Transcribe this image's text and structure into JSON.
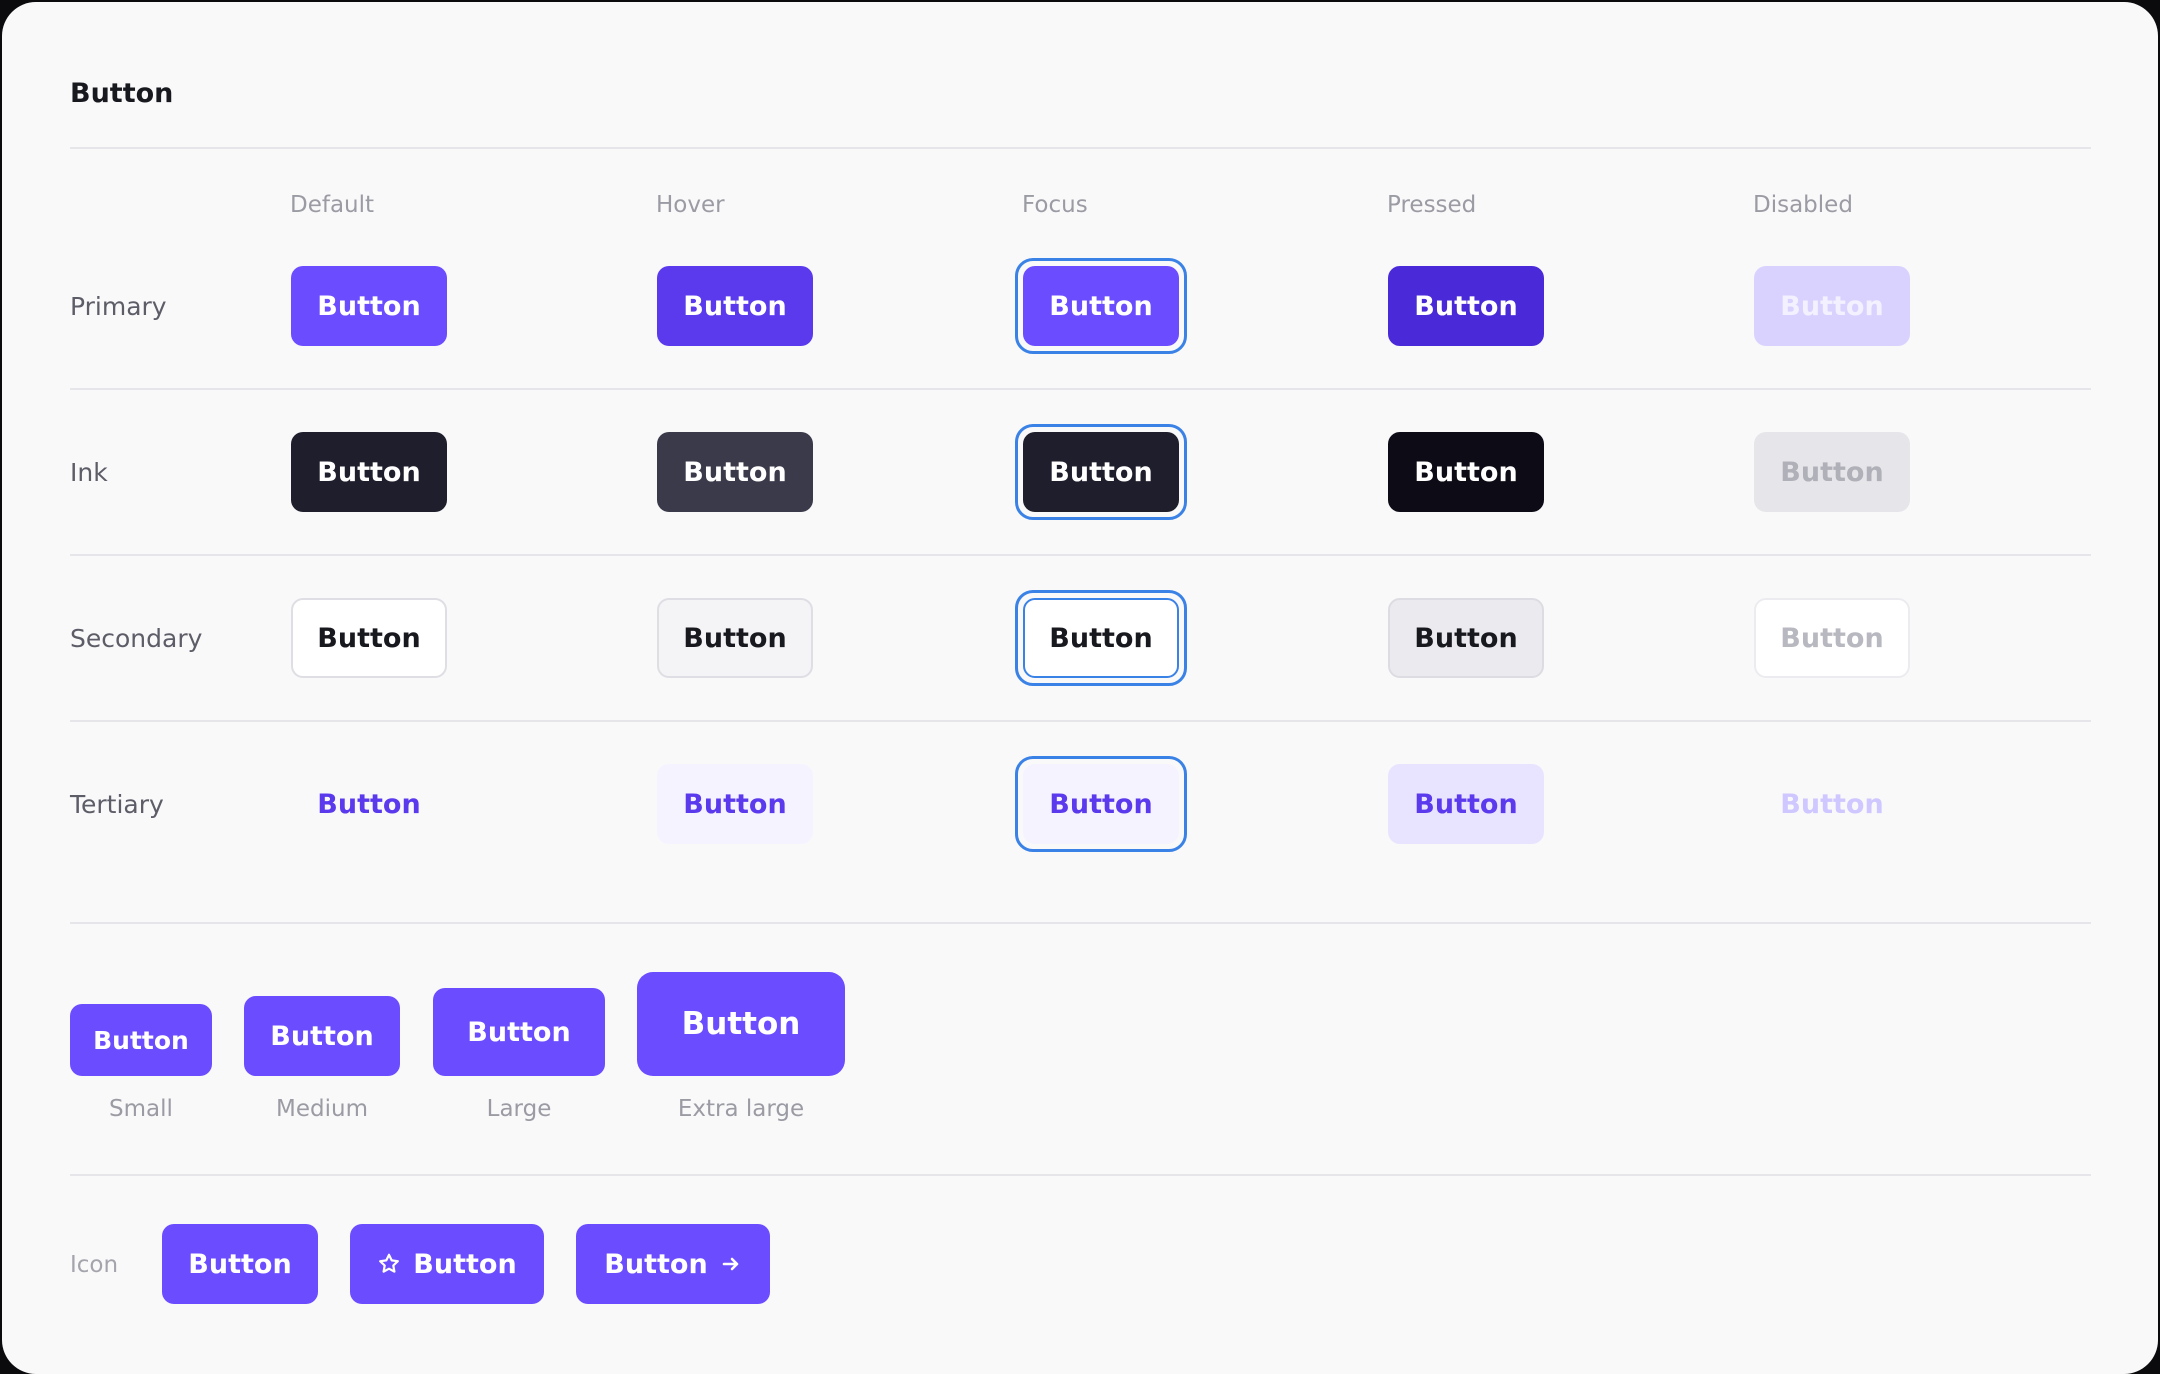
{
  "title": "Button",
  "states": [
    "Default",
    "Hover",
    "Focus",
    "Pressed",
    "Disabled"
  ],
  "button_label": "Button",
  "rows": [
    {
      "label": "Primary"
    },
    {
      "label": "Ink"
    },
    {
      "label": "Secondary"
    },
    {
      "label": "Tertiary"
    }
  ],
  "sizes": [
    "Small",
    "Medium",
    "Large",
    "Extra large"
  ],
  "icon_row": {
    "label": "Icon"
  },
  "colors": {
    "accent": "#6c4cff",
    "focus_ring": "#3b82e6",
    "ink": "#1f1e2c"
  },
  "icons": [
    "star-icon",
    "arrow-right-icon"
  ]
}
